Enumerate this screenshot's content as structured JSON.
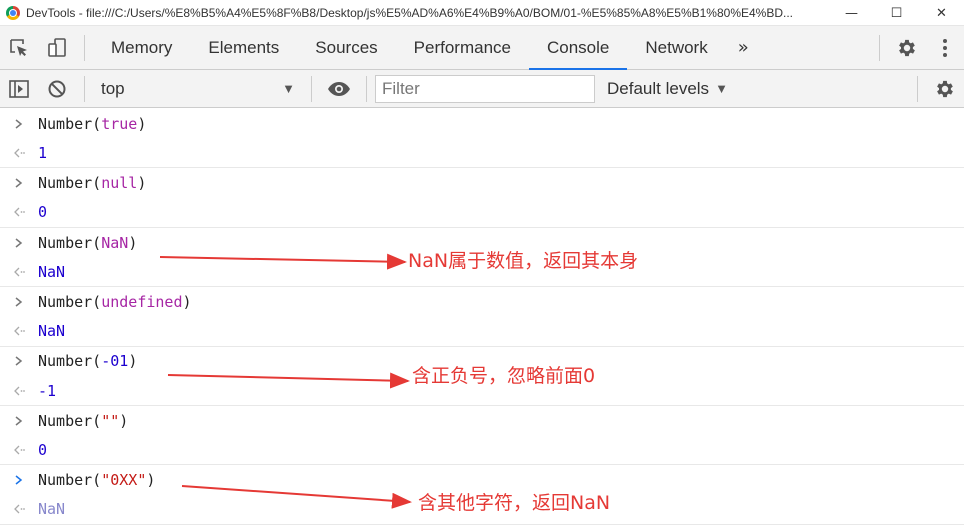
{
  "window": {
    "title": "DevTools - file:///C:/Users/%E8%B5%A4%E5%8F%B8/Desktop/js%E5%AD%A6%E4%B9%A0/BOM/01-%E5%85%A8%E5%B1%80%E4%BD...",
    "minimize": "—",
    "maximize": "☐",
    "close": "✕"
  },
  "tabs": [
    {
      "label": "Memory"
    },
    {
      "label": "Elements"
    },
    {
      "label": "Sources"
    },
    {
      "label": "Performance"
    },
    {
      "label": "Console",
      "active": true
    },
    {
      "label": "Network"
    }
  ],
  "more_tabs": "»",
  "console_toolbar": {
    "context": "top",
    "filter_placeholder": "Filter",
    "levels": "Default levels"
  },
  "entries": [
    {
      "input_prefix": "Number(",
      "input_arg": "true",
      "arg_type": "kw",
      "input_suffix": ")",
      "output": "1"
    },
    {
      "input_prefix": "Number(",
      "input_arg": "null",
      "arg_type": "kw",
      "input_suffix": ")",
      "output": "0"
    },
    {
      "input_prefix": "Number(",
      "input_arg": "NaN",
      "arg_type": "kw",
      "input_suffix": ")",
      "output": "NaN"
    },
    {
      "input_prefix": "Number(",
      "input_arg": "undefined",
      "arg_type": "kw",
      "input_suffix": ")",
      "output": "NaN"
    },
    {
      "input_prefix": "Number(",
      "input_arg": "-01",
      "arg_type": "num",
      "input_suffix": ")",
      "output": "-1"
    },
    {
      "input_prefix": "Number(",
      "input_arg": "\"\"",
      "arg_type": "str",
      "input_suffix": ")",
      "output": "0"
    },
    {
      "input_prefix": "Number(",
      "input_arg": "\"0XX\"",
      "arg_type": "str",
      "input_suffix": ")",
      "output": "NaN"
    }
  ],
  "annotations": [
    {
      "text": "NaN属于数值，返回其本身"
    },
    {
      "text": "含正负号，忽略前面0"
    },
    {
      "text": "含其他字符，返回NaN"
    }
  ],
  "colors": {
    "annotation": "#e53935",
    "active_tab_underline": "#1a73e8",
    "keyword": "#a626a4",
    "number": "#1c00cf",
    "string": "#c41a16"
  },
  "icons": [
    "inspect-element-icon",
    "device-toolbar-icon",
    "settings-gear-icon",
    "kebab-menu-icon",
    "sidebar-toggle-icon",
    "clear-console-icon",
    "eye-icon",
    "dropdown-arrow-icon"
  ]
}
